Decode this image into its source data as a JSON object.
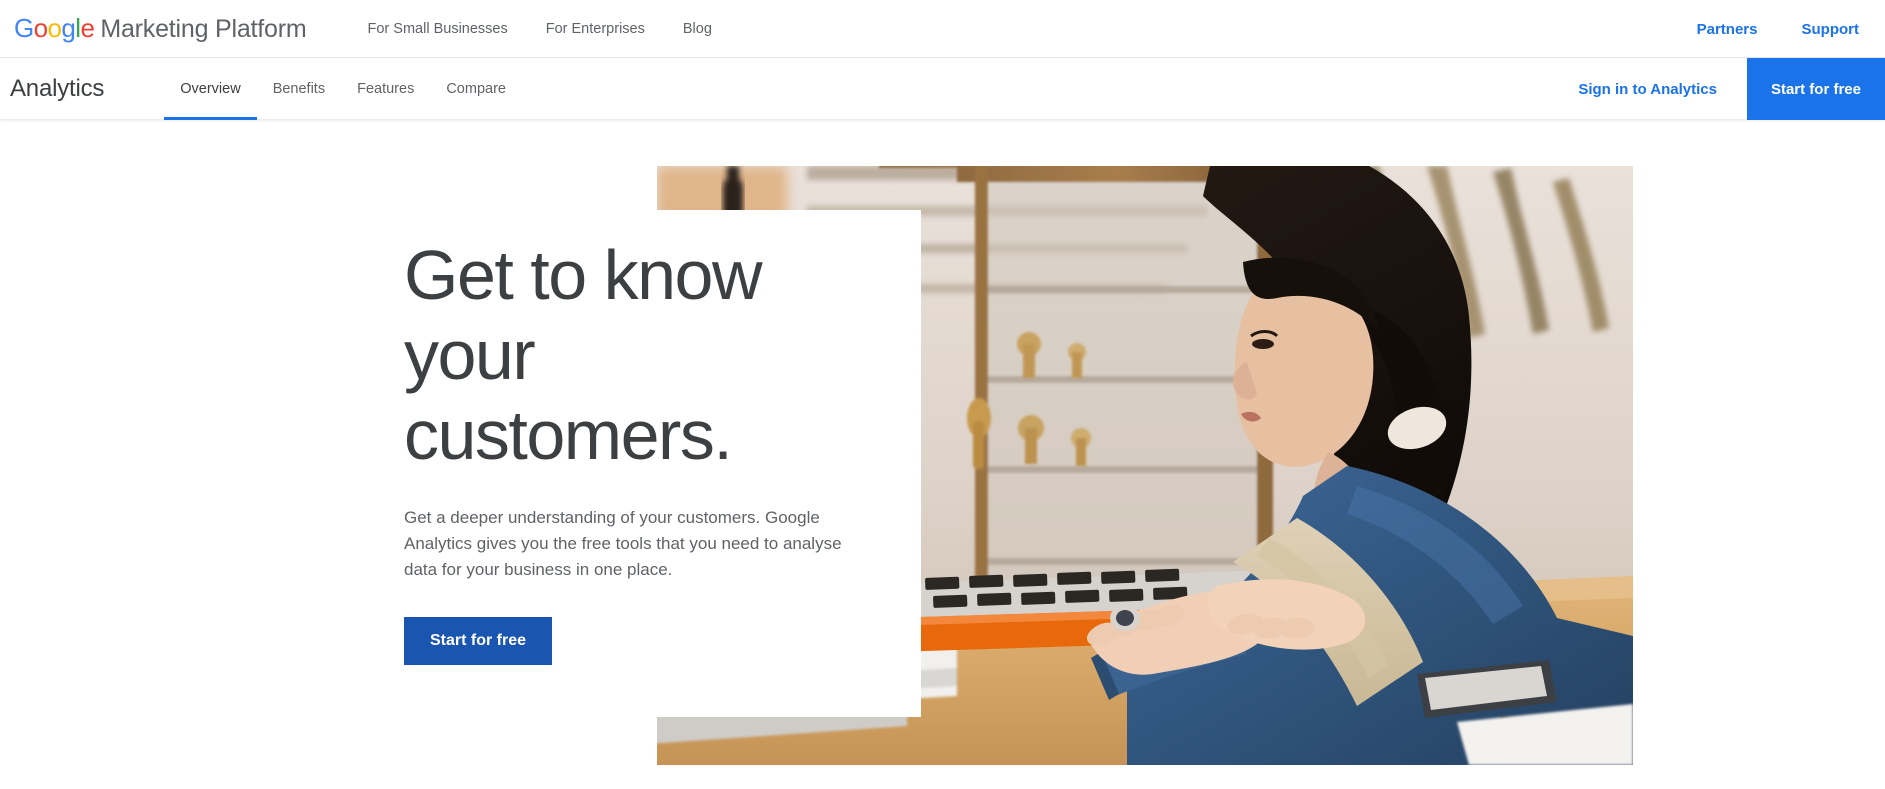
{
  "topbar": {
    "brand": {
      "logo_letters": [
        {
          "char": "G",
          "color": "#4285f4"
        },
        {
          "char": "o",
          "color": "#ea4335"
        },
        {
          "char": "o",
          "color": "#fbbc05"
        },
        {
          "char": "g",
          "color": "#4285f4"
        },
        {
          "char": "l",
          "color": "#34a853"
        },
        {
          "char": "e",
          "color": "#ea4335"
        }
      ],
      "logo_text": "Google",
      "suffix": "Marketing Platform"
    },
    "nav": [
      {
        "label": "For Small Businesses"
      },
      {
        "label": "For Enterprises"
      },
      {
        "label": "Blog"
      }
    ],
    "right_links": [
      {
        "label": "Partners"
      },
      {
        "label": "Support"
      }
    ]
  },
  "navbar": {
    "product": "Analytics",
    "tabs": [
      {
        "label": "Overview",
        "active": true
      },
      {
        "label": "Benefits",
        "active": false
      },
      {
        "label": "Features",
        "active": false
      },
      {
        "label": "Compare",
        "active": false
      }
    ],
    "signin_label": "Sign in to Analytics",
    "cta_label": "Start for free"
  },
  "hero": {
    "title": "Get to know your customers.",
    "subtitle": "Get a deeper understanding of your customers. Google Analytics gives you the free tools that you need to analyse data for your business in one place.",
    "cta_label": "Start for free",
    "image_alt": "Woman in denim shirt and apron working on a laptop at a wooden shop counter"
  },
  "colors": {
    "accent_blue": "#1a73e8",
    "hero_button_blue": "#1a56b0",
    "text_dark": "#3c4043",
    "text_muted": "#5f6368"
  }
}
